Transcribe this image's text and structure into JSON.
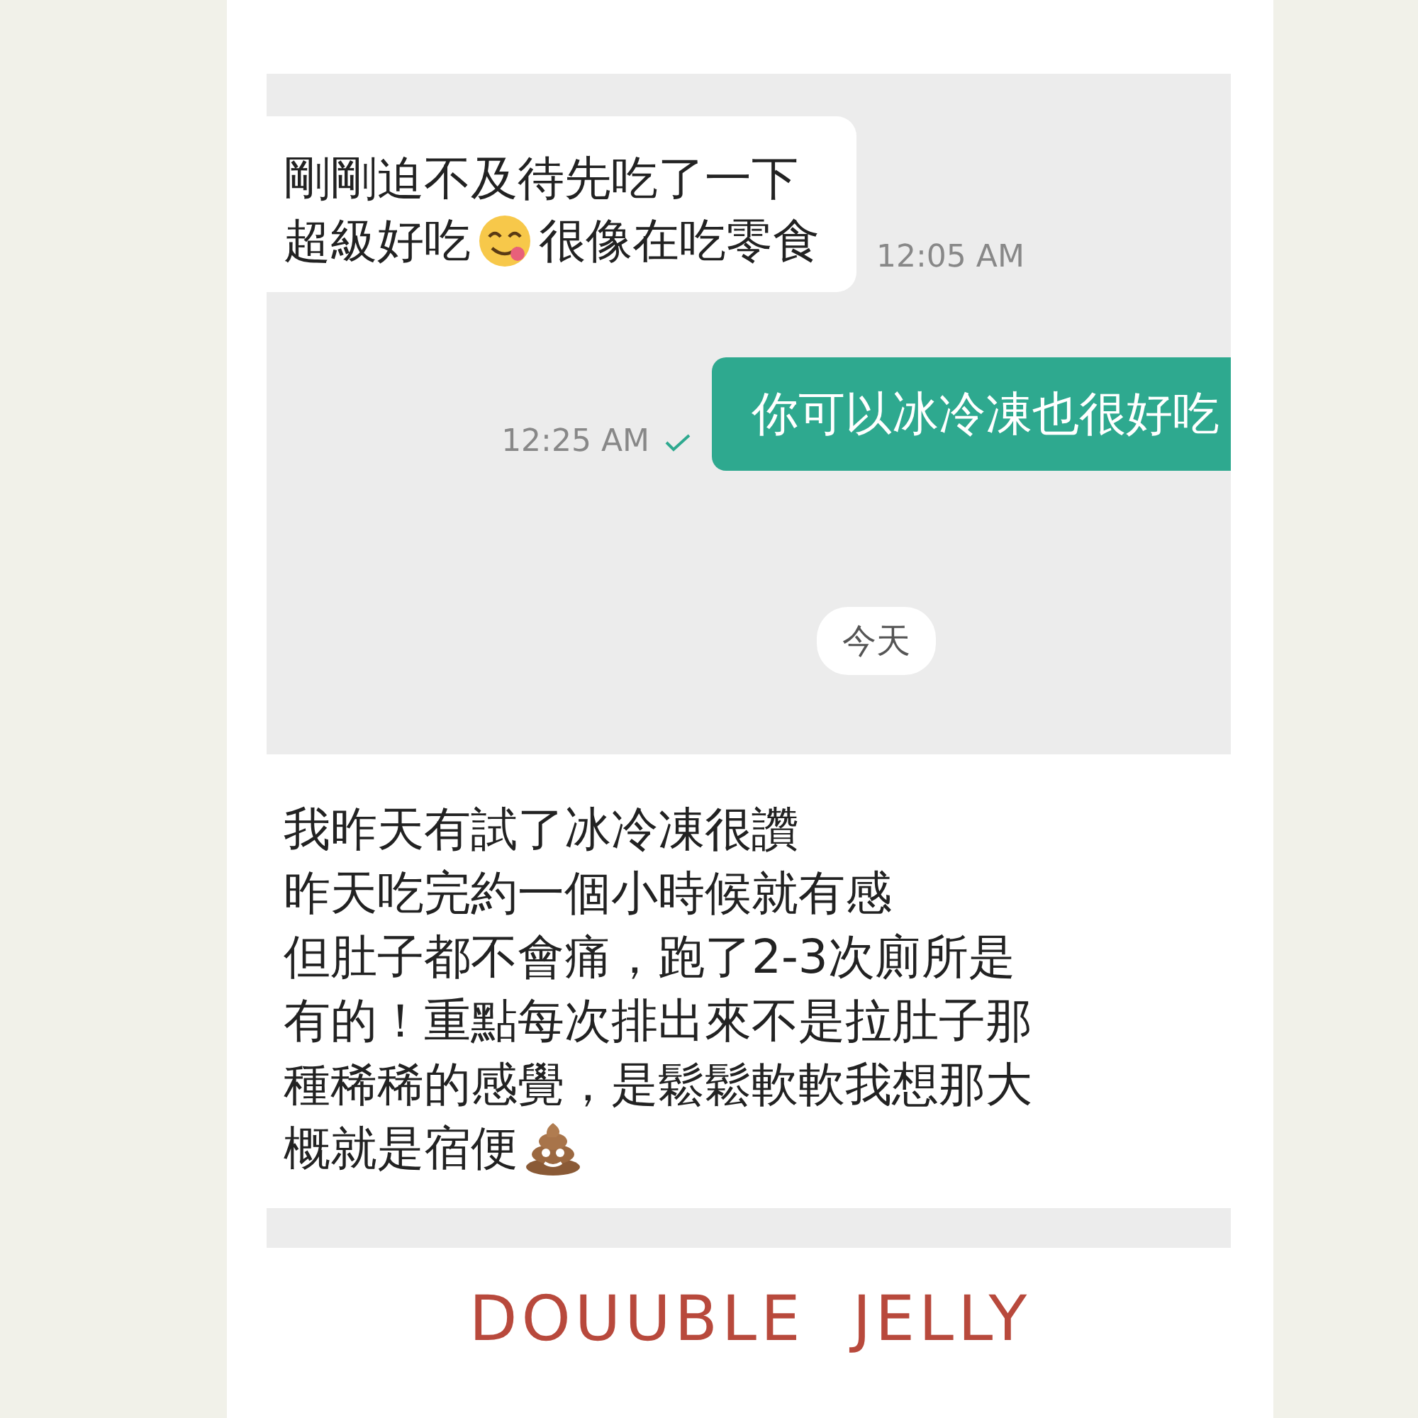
{
  "chat": {
    "messages": [
      {
        "kind": "received",
        "lines": [
          [
            {
              "kind": "text",
              "text": "剛剛迫不及待先吃了一下"
            }
          ],
          [
            {
              "kind": "text",
              "text": "超級好吃"
            },
            {
              "kind": "yum"
            },
            {
              "kind": "text",
              "text": "很像在吃零食"
            }
          ]
        ],
        "time": "12:05 AM",
        "delivered": false
      },
      {
        "kind": "sent",
        "lines": [
          [
            {
              "kind": "text",
              "text": "你可以冰冷凍也很好吃"
            }
          ]
        ],
        "time": "12:25 AM",
        "delivered": true
      }
    ],
    "date_divider": "今天"
  },
  "note": {
    "lines": [
      [
        {
          "kind": "text",
          "text": "我昨天有試了冰冷凍很讚"
        }
      ],
      [
        {
          "kind": "text",
          "text": "昨天吃完約一個小時候就有感"
        }
      ],
      [
        {
          "kind": "text",
          "text": "但肚子都不會痛，跑了2-3次廁所是"
        }
      ],
      [
        {
          "kind": "text",
          "text": "有的！重點每次排出來不是拉肚子那"
        }
      ],
      [
        {
          "kind": "text",
          "text": "種稀稀的感覺，是鬆鬆軟軟我想那大"
        }
      ],
      [
        {
          "kind": "text",
          "text": "概就是宿便"
        },
        {
          "kind": "poop"
        }
      ]
    ]
  },
  "brand": "DOUUBLE  JELLY"
}
